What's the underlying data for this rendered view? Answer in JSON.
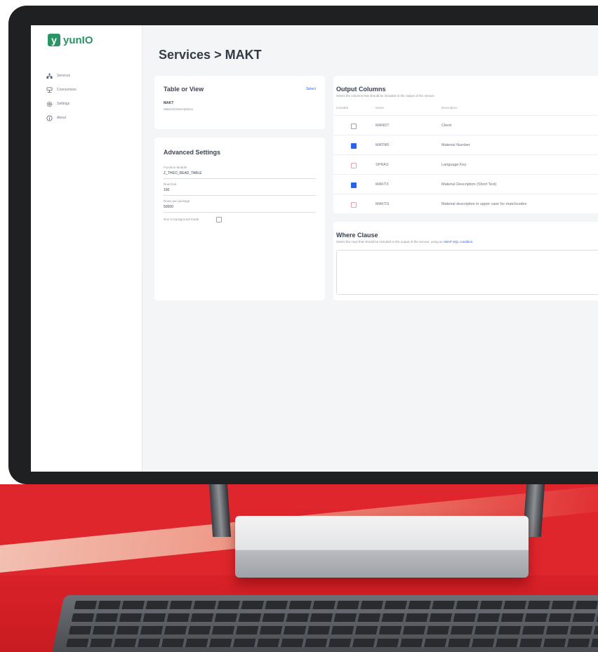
{
  "app": {
    "logo_mark": "y",
    "logo_text": "yunIO",
    "brand_color": "#1a8c5a"
  },
  "sidebar": {
    "items": [
      {
        "label": "Services",
        "icon": "services-icon"
      },
      {
        "label": "Connections",
        "icon": "connections-icon"
      },
      {
        "label": "Settings",
        "icon": "gear-icon"
      },
      {
        "label": "About",
        "icon": "info-icon"
      }
    ]
  },
  "page": {
    "title": "Services > MAKT"
  },
  "table_or_view": {
    "title": "Table or View",
    "select_label": "Select",
    "name": "MAKT",
    "description": "Material Descriptions"
  },
  "advanced_settings": {
    "title": "Advanced Settings",
    "function_module_label": "Function Module",
    "function_module_value": "Z_THEO_READ_TABLE",
    "row_limit_label": "Row limit",
    "row_limit_value": "100",
    "rows_per_package_label": "Rows per package",
    "rows_per_package_value": "50000",
    "background_mode_label": "Run in background mode"
  },
  "output_columns": {
    "title": "Output Columns",
    "subtitle": "Select the columns that should be included in the output of the service.",
    "headers": [
      "Included",
      "Name",
      "Description"
    ],
    "rows": [
      {
        "name": "MANDT",
        "description": "Client",
        "checked": false
      },
      {
        "name": "MATNR",
        "description": "Material Number",
        "checked": true
      },
      {
        "name": "SPRAS",
        "description": "Language Key",
        "checked": false
      },
      {
        "name": "MAKTX",
        "description": "Material Description (Short Text)",
        "checked": true
      },
      {
        "name": "MAKTG",
        "description": "Material description in upper case for matchcodes",
        "checked": false
      }
    ]
  },
  "where_clause": {
    "title": "Where Clause",
    "subtitle": "Select the rows that should be included in the output of the service, using an",
    "link_text": "ABAP SQL condition.",
    "value": ""
  },
  "colors": {
    "accent": "#2563eb",
    "desk_red": "#e0262d"
  }
}
